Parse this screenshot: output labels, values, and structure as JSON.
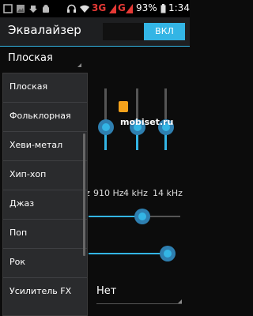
{
  "status_bar": {
    "network": "3G",
    "network2": "G",
    "battery": "93%",
    "time": "1:34"
  },
  "header": {
    "title": "Эквалайзер",
    "toggle_label": "ВКЛ"
  },
  "preset": {
    "selected": "Плоская"
  },
  "dropdown": {
    "items": [
      "Плоская",
      "Фольклорная",
      "Хеви-метал",
      "Хип-хоп",
      "Джаз",
      "Поп",
      "Рок",
      "Усилитель FX"
    ]
  },
  "equalizer": {
    "bands": [
      {
        "label": "910 Hz",
        "level": 0.5
      },
      {
        "label": "4 kHz",
        "level": 0.5
      },
      {
        "label": "14 kHz",
        "level": 0.5
      }
    ],
    "partial_band_label": "z"
  },
  "bass_boost": {
    "level": 0.65
  },
  "virtualizer": {
    "level": 0.95
  },
  "reverb": {
    "value": "Нет"
  },
  "watermark": "mobiset.ru",
  "colors": {
    "accent": "#33b5e5",
    "background": "#0c0c0c"
  }
}
